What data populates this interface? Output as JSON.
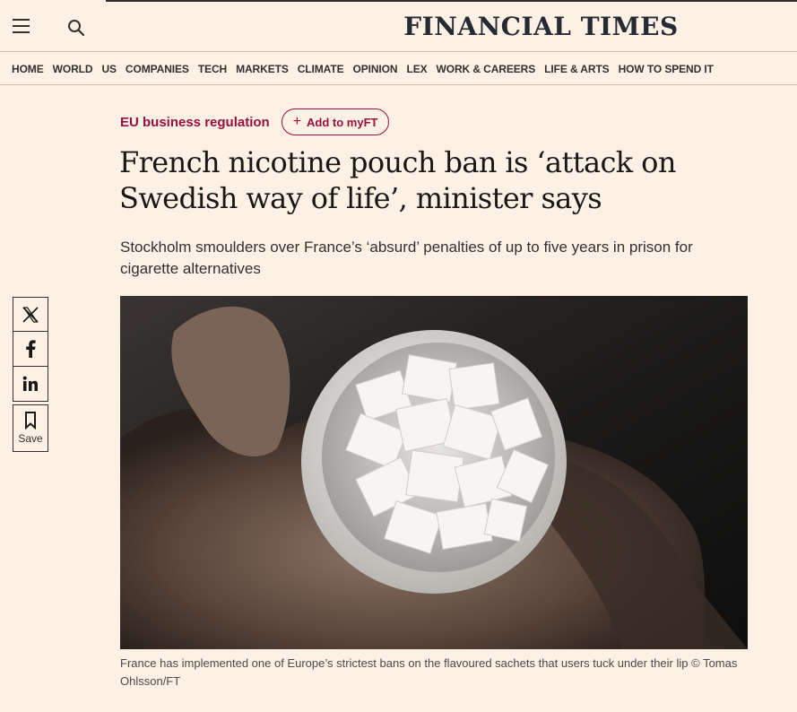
{
  "brand": {
    "name": "FINANCIAL TIMES"
  },
  "header": {
    "menu_icon": "hamburger-icon",
    "search_icon": "search-icon"
  },
  "nav": {
    "items": [
      "HOME",
      "WORLD",
      "US",
      "COMPANIES",
      "TECH",
      "MARKETS",
      "CLIMATE",
      "OPINION",
      "LEX",
      "WORK & CAREERS",
      "LIFE & ARTS",
      "HOW TO SPEND IT"
    ]
  },
  "article": {
    "topic": "EU business regulation",
    "myft_label": "Add to myFT",
    "headline": "French nicotine pouch ban is ‘attack on Swedish way of life’, minister says",
    "standfirst": "Stockholm smoulders over France’s ‘absurd’ penalties of up to five years in prison for cigarette alternatives",
    "caption": "France has implemented one of Europe’s strictest bans on the flavoured sachets that users tuck under their lip © Tomas Ohlsson/FT"
  },
  "share": {
    "save_label": "Save",
    "icons": [
      "x-icon",
      "facebook-icon",
      "linkedin-icon",
      "bookmark-icon"
    ]
  },
  "colors": {
    "background": "#fdf1e6",
    "accent": "#990f3d",
    "text": "#33302e"
  }
}
